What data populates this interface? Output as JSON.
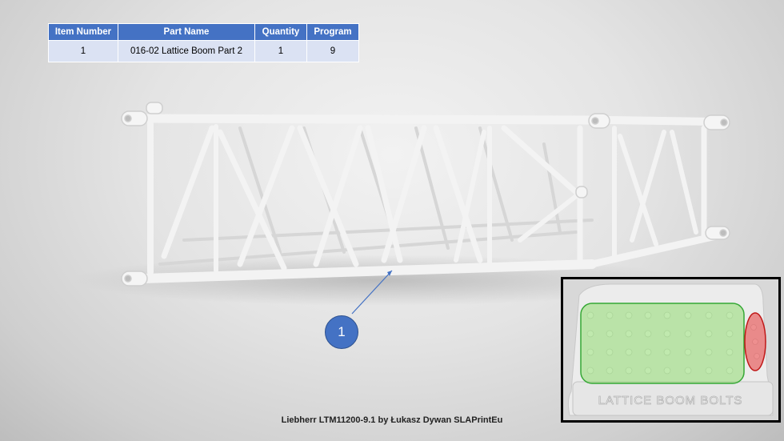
{
  "table": {
    "headers": [
      "Item Number",
      "Part Name",
      "Quantity",
      "Program"
    ],
    "rows": [
      [
        "1",
        "016-02 Lattice Boom Part 2",
        "1",
        "9"
      ]
    ]
  },
  "callout": {
    "label": "1"
  },
  "caption": "Liebherr LTM11200-9.1 by Łukasz Dywan SLAPrintEu",
  "inset": {
    "embossed_text": "LATTICE BOOM BOLTS"
  },
  "colors": {
    "table_header": "#4472c4",
    "table_row": "#dbe2f3",
    "callout": "#4472c4",
    "highlight_green": "#7ed957",
    "highlight_red": "#e83a3a"
  }
}
